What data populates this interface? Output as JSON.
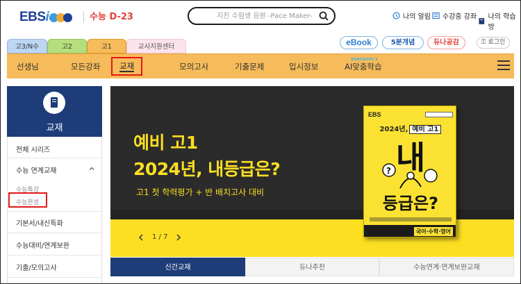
{
  "header": {
    "logo_text": "EBS",
    "logo_i": "i",
    "dday": "수능 D-23",
    "search_placeholder": "지친 수험생 응원 -Pace Maker-",
    "utils": [
      {
        "label": "나의 알림",
        "icon": "clock-icon"
      },
      {
        "label": "수강중 강좌",
        "icon": "lecture-icon"
      },
      {
        "label": "나의 학습방",
        "icon": "book-icon"
      }
    ]
  },
  "grade_tabs": [
    "고3/N수",
    "고2",
    "고1",
    "교사지원센터"
  ],
  "service_pills": {
    "ebook": "eBook",
    "five": "5분개념",
    "duna": "듀나공감",
    "login": "로그인"
  },
  "nav": {
    "items": [
      "선생님",
      "모든강좌",
      "교재",
      "모의고사",
      "기출문제",
      "입시정보",
      "AI맞춤학습"
    ],
    "ai_tag": "DANCHOOL'S",
    "active": "교재"
  },
  "sidebar": {
    "title": "교재",
    "items": [
      "전체 시리즈",
      "수능 연계교재",
      "기본서/내신특화",
      "수능대비/연계보완",
      "기출/모의고사"
    ],
    "sub_items": [
      "수능특강",
      "수능완성"
    ]
  },
  "banner": {
    "line1": "예비 고1",
    "line2": "2024년, 내등급은?",
    "sub": "고1 첫 학력평가 + 반 배치고사 대비",
    "pager": "1 / 7",
    "book": {
      "ebs": "EBS",
      "line": "2024년,",
      "highlight": "예비 고1",
      "big1": "내",
      "big2": "등급은?",
      "subjects": "국어·수학·영어"
    }
  },
  "bottom_tabs": [
    "신간교재",
    "듀나추천",
    "수능연계·연계보완교재"
  ],
  "colors": {
    "navy": "#1d3c78",
    "orange": "#f6bb5a",
    "yellow": "#fcdf21",
    "red": "#e11818"
  }
}
